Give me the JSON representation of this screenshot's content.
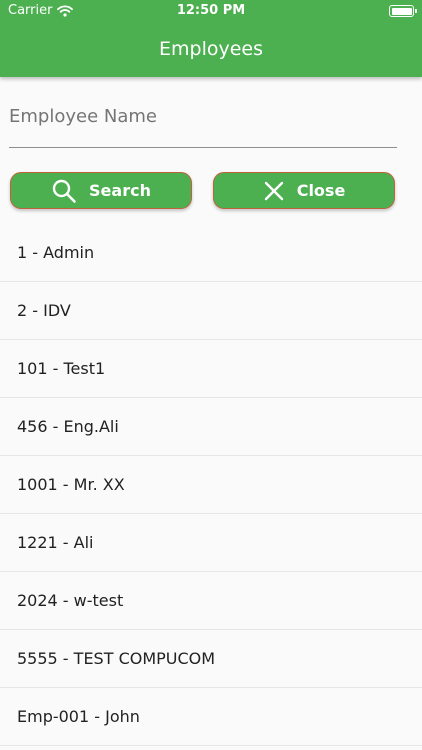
{
  "status_bar": {
    "carrier": "Carrier",
    "time": "12:50 PM"
  },
  "header": {
    "title": "Employees",
    "background_color": "#4caf50"
  },
  "search": {
    "placeholder": "Employee Name",
    "value": ""
  },
  "buttons": {
    "search_label": "Search",
    "search_icon": "search-icon",
    "close_label": "Close",
    "close_icon": "close-icon",
    "background_color": "#4caf50",
    "border_color": "#c0623a"
  },
  "employees": [
    {
      "label": "1 - Admin"
    },
    {
      "label": "2 - IDV"
    },
    {
      "label": "101 - Test1"
    },
    {
      "label": "456 - Eng.Ali"
    },
    {
      "label": "1001 - Mr. XX"
    },
    {
      "label": "1221 - Ali"
    },
    {
      "label": "2024 - w-test"
    },
    {
      "label": "5555 - TEST COMPUCOM"
    },
    {
      "label": "Emp-001 - John"
    }
  ]
}
